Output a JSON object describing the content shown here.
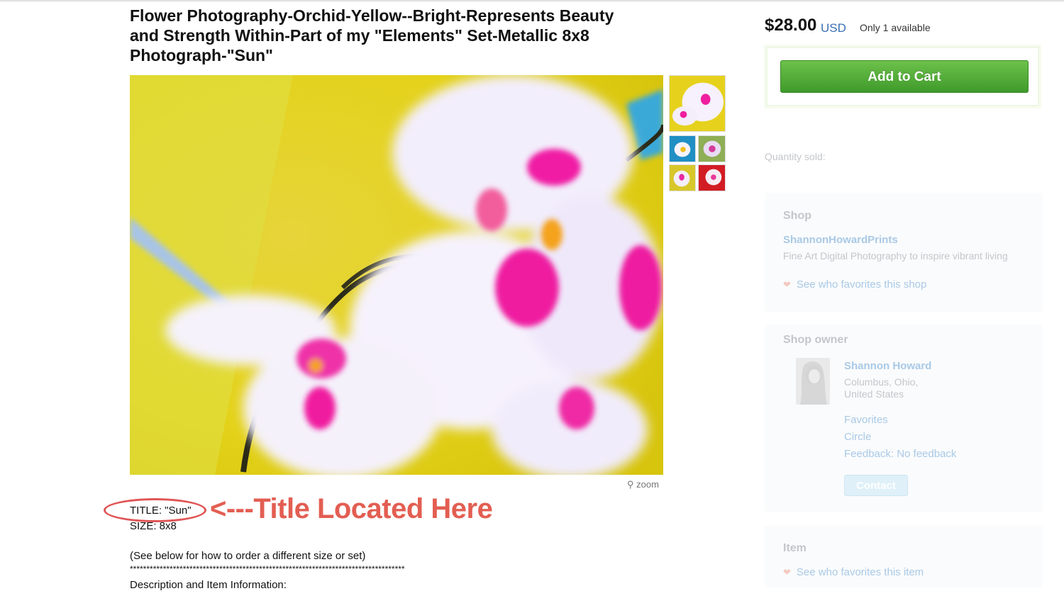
{
  "listing": {
    "title": "Flower Photography-Orchid-Yellow--Bright-Represents Beauty and Strength Within-Part of my \"Elements\" Set-Metallic 8x8 Photograph-\"Sun\"",
    "zoom_label": "zoom",
    "description": {
      "title_line": "TITLE: \"Sun\"",
      "size_line": "SIZE: 8x8",
      "order_note": "(See below for how to order a different size or set)",
      "separator": "***********************************************************************************",
      "section_heading": "Description and Item Information:"
    },
    "annotation": "<---Title Located Here"
  },
  "purchase": {
    "price": "$28.00",
    "currency": "USD",
    "availability": "Only 1 available",
    "add_to_cart_label": "Add to Cart",
    "quantity_sold_label": "Quantity sold:"
  },
  "shop": {
    "heading": "Shop",
    "name": "ShannonHowardPrints",
    "tagline": "Fine Art Digital Photography to inspire vibrant living",
    "favorites_link": "See who favorites this shop"
  },
  "owner": {
    "heading": "Shop owner",
    "name": "Shannon Howard",
    "location_line1": "Columbus, Ohio,",
    "location_line2": "United States",
    "favorites": "Favorites",
    "circle": "Circle",
    "feedback": "Feedback: No feedback",
    "contact_label": "Contact"
  },
  "item": {
    "heading": "Item",
    "favorites_link": "See who favorites this item"
  },
  "colors": {
    "accent_green": "#4caf37",
    "link_blue": "#3b6fb6",
    "annotation_red": "#e35e52"
  }
}
